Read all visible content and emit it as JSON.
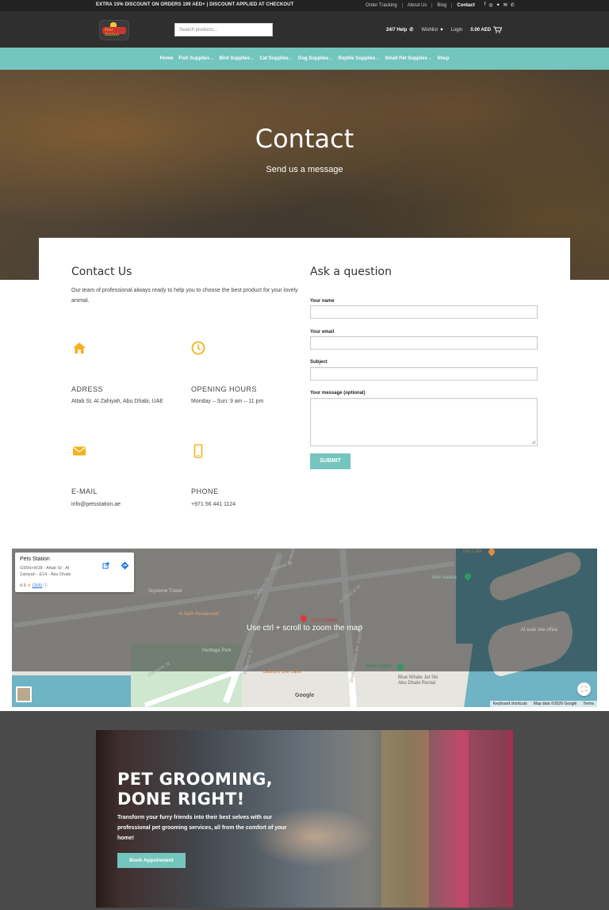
{
  "topbar": {
    "promo": "EXTRA 15% DISCOUNT ON ORDERS 199 AED+ | DISCOUNT APPLIED AT CHECKOUT",
    "links": [
      "Order Tracking",
      "About Us",
      "Blog",
      "Contact"
    ],
    "social": [
      "facebook-icon",
      "instagram-icon",
      "twitter-icon",
      "mail-icon",
      "phone-icon"
    ]
  },
  "header": {
    "logo_text": "Pets Station",
    "search_placeholder": "Search products…",
    "help": "24/7 Help",
    "wishlist": "Wishlist",
    "login": "Login",
    "cart": "0.00 AED"
  },
  "nav": [
    "Home",
    "Fish Supplies",
    "Bird Supplies",
    "Cat Supplies",
    "Dog Supplies",
    "Reptile Supplies",
    "Small Pet Supplies",
    "Shop"
  ],
  "hero": {
    "title": "Contact",
    "subtitle": "Send us a message"
  },
  "contact": {
    "title": "Contact Us",
    "intro": "Our team of professional always ready to help you to choose the best product for your lovely animal.",
    "address_label": "ADRESS",
    "address": "Attab St, Al Zahiyah, Abu Dhabi, UAE",
    "hours_label": "OPENING HOURS",
    "hours": "Monday – Sun: 9 am – 11 pm",
    "email_label": "E-MAIL",
    "email": "info@petsstation.ae",
    "phone_label": "PHONE",
    "phone": "+971 56 441 1124"
  },
  "form": {
    "title": "Ask a question",
    "name_label": "Your name",
    "email_label": "Your email",
    "subject_label": "Subject",
    "message_label": "Your message (optional)",
    "submit": "SUBMIT"
  },
  "map": {
    "place": "Pets Station",
    "address": "G95H+WJ8 - Attab St - Al Zahiyah - E14 - Abu Dhabi",
    "rating": "4.9",
    "reviews": "(116)",
    "hint": "Use ctrl + scroll to zoom the map",
    "pois": [
      "Supreme Travel",
      "Al Sarh Restaurant",
      "Heritage Park",
      "Labistro one caffe",
      "Blue Eagles",
      "Blue Whale Jet Ski Abu Dhabi Rental",
      "Zen Cafe",
      "Arlo marina",
      "Al wale site office",
      "Pets Station"
    ],
    "streets": [
      "Al Meena St",
      "Corniche St",
      "Shrahat St",
      "Al Meena St",
      "Al Ghazal St",
      "Sheikh Khalifa Bin Zayed St",
      "Corniche St"
    ],
    "logo": "Google",
    "footer": [
      "Keyboard shortcuts",
      "Map data ©2026 Google",
      "Terms"
    ]
  },
  "promo": {
    "title_line1": "PET GROOMING,",
    "title_line2": "DONE RIGHT!",
    "text": "Transform your furry friends into their best selves with our professional pet grooming services, all from the comfort of your home!",
    "button": "Book Appoinment"
  },
  "colors": {
    "accent": "#74c5be",
    "icon": "#f5b21b",
    "dark": "#2f2f2f"
  }
}
